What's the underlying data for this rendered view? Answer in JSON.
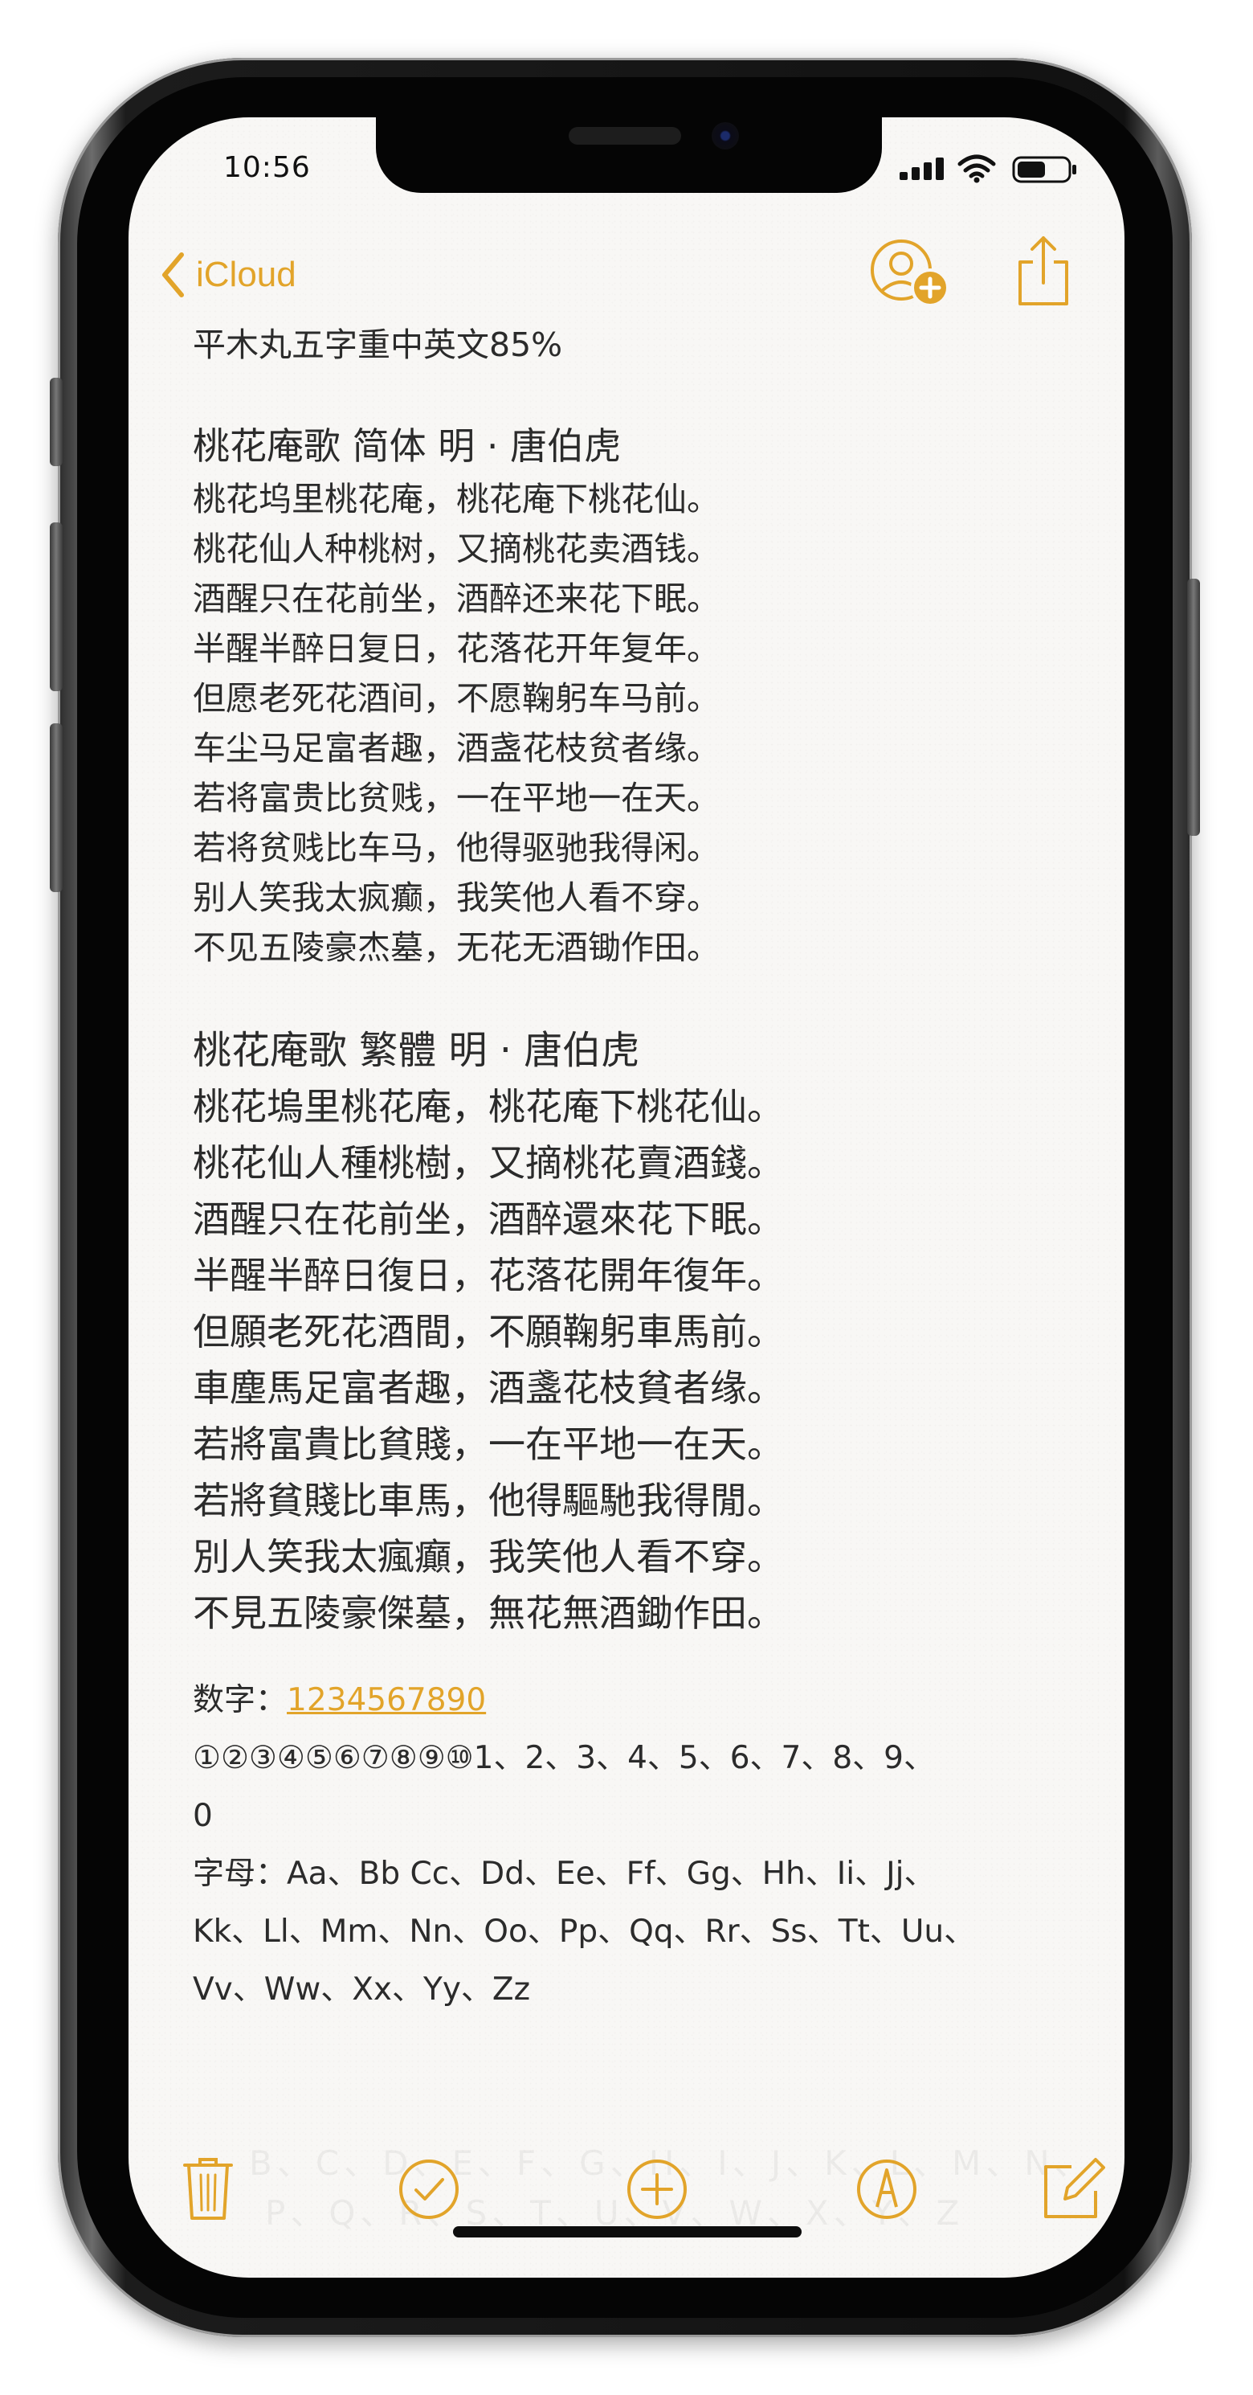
{
  "status_bar": {
    "time": "10:56"
  },
  "nav": {
    "back_label": "iCloud"
  },
  "note": {
    "subtitle": "平木丸五字重中英文85%",
    "simplified": {
      "heading": "桃花庵歌  简体   明 · 唐伯虎",
      "lines": [
        "桃花坞里桃花庵，桃花庵下桃花仙。",
        "桃花仙人种桃树，又摘桃花卖酒钱。",
        "酒醒只在花前坐，酒醉还来花下眠。",
        "半醒半醉日复日，花落花开年复年。",
        "但愿老死花酒间，不愿鞠躬车马前。",
        "车尘马足富者趣，酒盏花枝贫者缘。",
        "若将富贵比贫贱，一在平地一在天。",
        "若将贫贱比车马，他得驱驰我得闲。",
        "别人笑我太疯癫，我笑他人看不穿。",
        "不见五陵豪杰墓，无花无酒锄作田。"
      ]
    },
    "traditional": {
      "heading": "桃花庵歌  繁體     明 · 唐伯虎",
      "lines": [
        "桃花塢里桃花庵，桃花庵下桃花仙。",
        "桃花仙人種桃樹，又摘桃花賣酒錢。",
        "酒醒只在花前坐，酒醉還來花下眠。",
        "半醒半醉日復日，花落花開年復年。",
        "但願老死花酒間，不願鞠躬車馬前。",
        "車塵馬足富者趣，酒盞花枝貧者缘。",
        "若將富貴比貧賤，一在平地一在天。",
        "若將貧賤比車馬，他得驅馳我得閒。",
        "別人笑我太瘋癲，我笑他人看不穿。",
        "不見五陵豪傑墓，無花無酒鋤作田。"
      ]
    },
    "numbers_label": "数字：",
    "numbers_link": "1234567890",
    "circled_line1": "①②③④⑤⑥⑦⑧⑨⑩1、2、3、4、5、6、7、8、9、",
    "circled_line2": "0",
    "letters_line1": "字母：Aa、Bb Cc、Dd、Ee、Ff、Gg、Hh、Ii、Jj、",
    "letters_line2": "Kk、Ll、Mm、Nn、Oo、Pp、Qq、Rr、Ss、Tt、Uu、",
    "letters_line3": "Vv、Ww、Xx、Yy、Zz",
    "faded_line1": "B、C、D、E、F、G、H、I、J、K、L、M、N、",
    "faded_line2": "P、Q、R、S、T、U、V、W、X、Y、Z"
  },
  "colors": {
    "accent": "#e2a42a",
    "text": "#2b2b2b",
    "paper": "#f8f7f5"
  },
  "icons": [
    "chevron-left-icon",
    "person-add-icon",
    "share-icon",
    "trash-icon",
    "checklist-icon",
    "plus-circle-icon",
    "markup-icon",
    "compose-icon",
    "signal-icon",
    "wifi-icon",
    "battery-icon"
  ]
}
